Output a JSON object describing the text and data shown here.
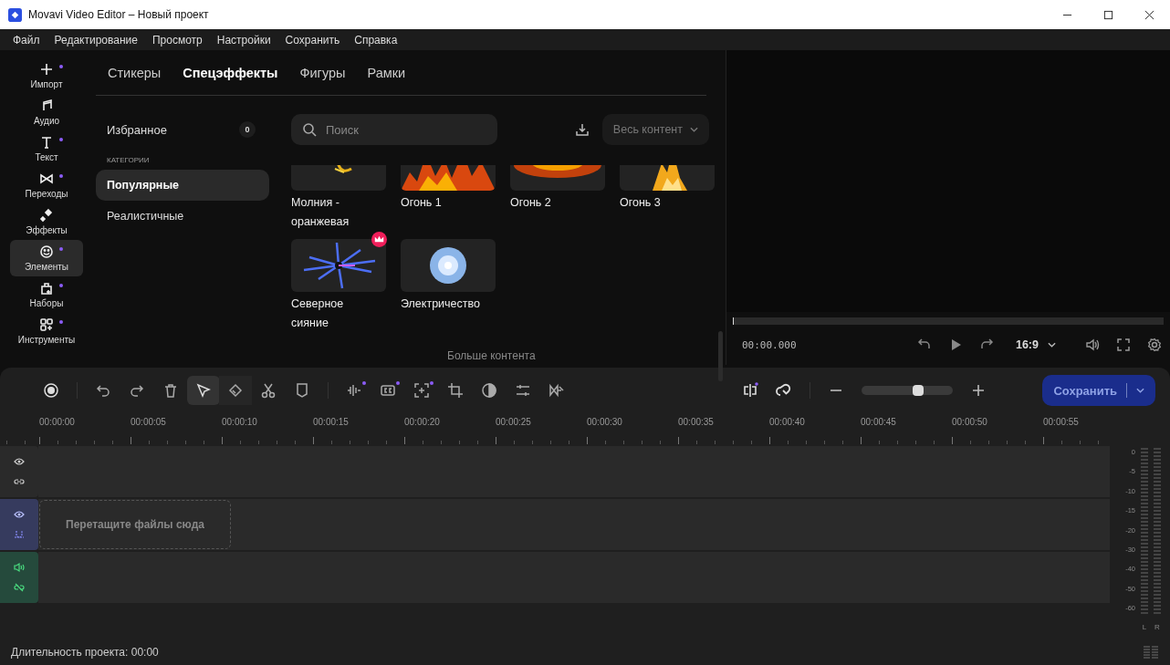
{
  "window": {
    "title": "Movavi Video Editor – Новый проект"
  },
  "menu": [
    "Файл",
    "Редактирование",
    "Просмотр",
    "Настройки",
    "Сохранить",
    "Справка"
  ],
  "sidebar": {
    "items": [
      {
        "kind": "import",
        "label": "Импорт",
        "badge": true,
        "selected": false
      },
      {
        "kind": "audio",
        "label": "Аудио",
        "badge": false,
        "selected": false
      },
      {
        "kind": "text",
        "label": "Текст",
        "badge": true,
        "selected": false
      },
      {
        "kind": "transitions",
        "label": "Переходы",
        "badge": true,
        "selected": false
      },
      {
        "kind": "effects",
        "label": "Эффекты",
        "badge": false,
        "selected": false
      },
      {
        "kind": "elements",
        "label": "Элементы",
        "badge": true,
        "selected": true
      },
      {
        "kind": "packs",
        "label": "Наборы",
        "badge": true,
        "selected": false
      },
      {
        "kind": "tools",
        "label": "Инструменты",
        "badge": true,
        "selected": false
      }
    ]
  },
  "tabs": [
    {
      "label": "Стикеры",
      "selected": false
    },
    {
      "label": "Спецэффекты",
      "selected": true
    },
    {
      "label": "Фигуры",
      "selected": false
    },
    {
      "label": "Рамки",
      "selected": false
    }
  ],
  "favorites": {
    "label": "Избранное",
    "count": "0"
  },
  "categories": {
    "heading": "КАТЕГОРИИ",
    "items": [
      {
        "label": "Популярные",
        "selected": true
      },
      {
        "label": "Реалистичные",
        "selected": false
      }
    ]
  },
  "search": {
    "placeholder": "Поиск"
  },
  "filter": {
    "label": "Весь контент"
  },
  "effects": [
    {
      "title": "Молния - оранжевая",
      "premium": false,
      "cropped": true
    },
    {
      "title": "Огонь 1",
      "premium": false,
      "cropped": true
    },
    {
      "title": "Огонь 2",
      "premium": false,
      "cropped": true
    },
    {
      "title": "Огонь 3",
      "premium": false,
      "cropped": true
    },
    {
      "title": "Северное сияние",
      "premium": true,
      "cropped": false
    },
    {
      "title": "Электричество",
      "premium": false,
      "cropped": false
    }
  ],
  "more_link": "Больше контента",
  "player": {
    "level": 0,
    "time": "00:00.000",
    "aspect": "16:9"
  },
  "toolbar": [
    {
      "kind": "record",
      "badge": false,
      "selected": false
    },
    {
      "kind": "undo",
      "badge": false,
      "selected": false
    },
    {
      "kind": "redo",
      "badge": false,
      "selected": false
    },
    {
      "kind": "delete",
      "badge": false,
      "selected": false
    },
    {
      "kind": "pointer",
      "badge": false,
      "selected": true
    },
    {
      "kind": "razor-tool",
      "badge": false,
      "selected": false
    },
    {
      "kind": "cut",
      "badge": false,
      "selected": false
    },
    {
      "kind": "marker",
      "badge": false,
      "selected": false
    },
    {
      "kind": "audio-wave",
      "badge": true,
      "selected": false
    },
    {
      "kind": "captions",
      "badge": true,
      "selected": false
    },
    {
      "kind": "focus",
      "badge": true,
      "selected": false
    },
    {
      "kind": "crop",
      "badge": false,
      "selected": false
    },
    {
      "kind": "color",
      "badge": false,
      "selected": false
    },
    {
      "kind": "adjust",
      "badge": false,
      "selected": false
    },
    {
      "kind": "transition",
      "badge": false,
      "selected": false
    }
  ],
  "zoom": {
    "level": 0.62
  },
  "save_button": "Сохранить",
  "ruler": [
    "00:00:00",
    "00:00:05",
    "00:00:10",
    "00:00:15",
    "00:00:20",
    "00:00:25",
    "00:00:30",
    "00:00:35",
    "00:00:40",
    "00:00:45",
    "00:00:50",
    "00:00:55"
  ],
  "tracks": [
    {
      "kind": "overlay"
    },
    {
      "kind": "main",
      "placeholder": "Перетащите файлы сюда"
    },
    {
      "kind": "audio"
    }
  ],
  "meter": {
    "scale": [
      "0",
      "-5",
      "-10",
      "-15",
      "-20",
      "-30",
      "-40",
      "-50",
      "-60"
    ],
    "channels": [
      "L",
      "R"
    ]
  },
  "status_bar": "Длительность проекта: 00:00"
}
